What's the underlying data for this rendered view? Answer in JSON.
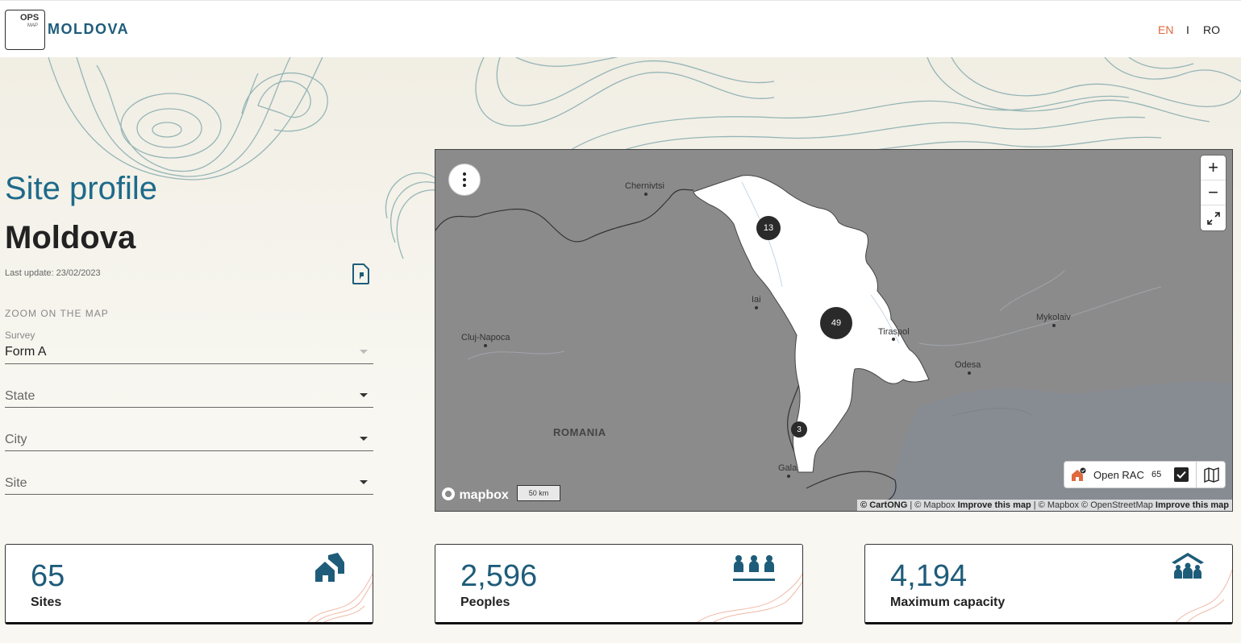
{
  "header": {
    "logo_ops": "OPS",
    "logo_map": "MAP",
    "logo_name": "MOLDOVA",
    "languages": [
      {
        "label": "EN",
        "active": true
      },
      {
        "label": "I"
      },
      {
        "label": "RO"
      }
    ]
  },
  "profile": {
    "title": "Site profile",
    "country": "Moldova",
    "last_update": "Last update: 23/02/2023"
  },
  "filters": {
    "section_label": "ZOOM ON THE MAP",
    "survey_label": "Survey",
    "survey_value": "Form A",
    "state_placeholder": "State",
    "city_placeholder": "City",
    "site_placeholder": "Site"
  },
  "map": {
    "places": {
      "chernivtsi": "Chernivtsi",
      "iasi": "Iai",
      "cluj": "Cluj-Napoca",
      "tiraspol": "Tiraspol",
      "odesa": "Odesa",
      "mykolaiv": "Mykolaiv",
      "romania": "ROMANIA",
      "galati": "Gala"
    },
    "clusters": [
      "13",
      "49",
      "3"
    ],
    "legend_label": "Open RAC",
    "legend_count": "65",
    "scale_label": "50 km",
    "mapbox_label": "mapbox",
    "attr_cartong": "© CartONG",
    "attr_mapbox1": "| © Mapbox",
    "attr_improve1": "Improve this map",
    "attr_mapbox2": "| © Mapbox © OpenStreetMap",
    "attr_improve2": "Improve this map",
    "zoom_in": "+",
    "zoom_out": "−"
  },
  "stats": [
    {
      "value": "65",
      "label": "Sites"
    },
    {
      "value": "2,596",
      "label": "Peoples"
    },
    {
      "value": "4,194",
      "label": "Maximum capacity"
    }
  ],
  "colors": {
    "primary": "#1e5c7a",
    "accent": "#e0693e",
    "map_land": "#8b8b8b",
    "moldova": "#ffffff",
    "sea": "#8a8e94"
  }
}
